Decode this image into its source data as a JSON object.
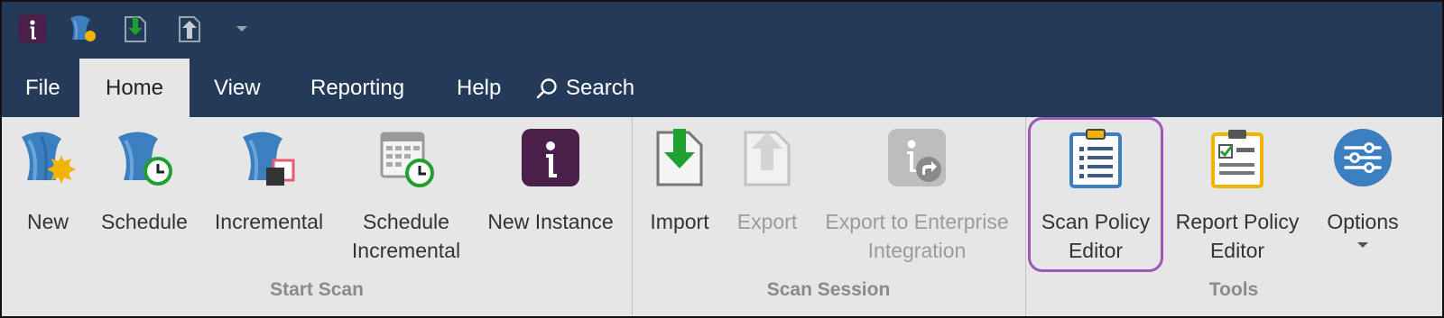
{
  "menu": {
    "file": "File",
    "home": "Home",
    "view": "View",
    "reporting": "Reporting",
    "help": "Help",
    "search": "Search"
  },
  "quick_access": {
    "icons": [
      "app-logo-icon",
      "new-scan-icon",
      "import-icon",
      "export-icon",
      "customize-dropdown-icon"
    ]
  },
  "groups": {
    "start_scan": {
      "label": "Start Scan",
      "buttons": {
        "new": "New",
        "schedule": "Schedule",
        "incremental": "Incremental",
        "schedule_incremental": "Schedule\nIncremental",
        "new_instance": "New Instance"
      }
    },
    "scan_session": {
      "label": "Scan Session",
      "buttons": {
        "import": "Import",
        "export": "Export",
        "export_enterprise": "Export to Enterprise\nIntegration"
      }
    },
    "tools": {
      "label": "Tools",
      "buttons": {
        "scan_policy_editor": "Scan Policy\nEditor",
        "report_policy_editor": "Report Policy\nEditor",
        "options": "Options"
      }
    }
  },
  "colors": {
    "titlebar": "#243a59",
    "ribbon": "#e6e6e6",
    "highlight": "#9b59b6",
    "brand_purple": "#4a1f4a",
    "shark_blue": "#3c7fc0",
    "accent_green": "#1fa12f",
    "accent_yellow": "#f3b400"
  }
}
